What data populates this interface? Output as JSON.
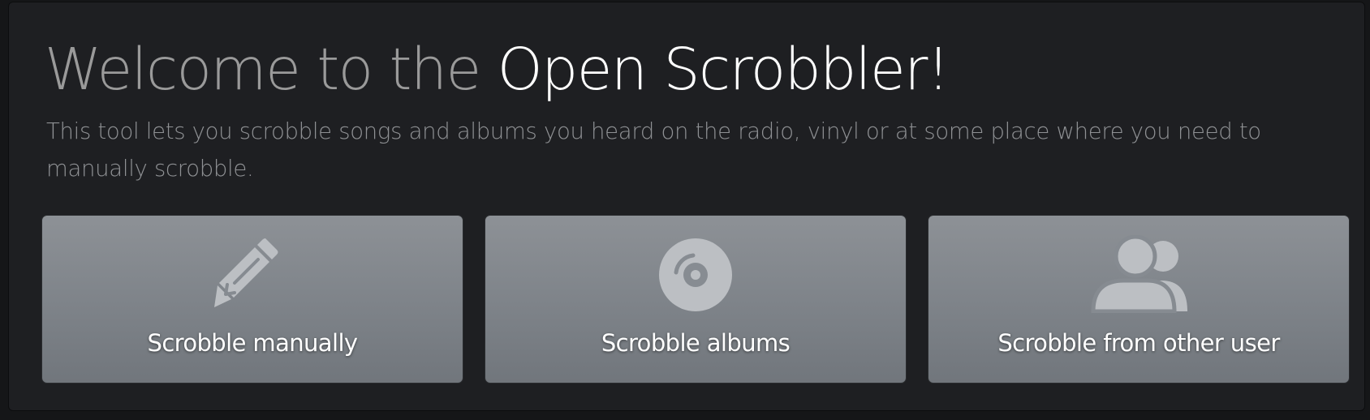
{
  "header": {
    "title_prefix": "Welcome to the ",
    "title_brand": "Open Scrobbler!",
    "subtitle": "This tool lets you scrobble songs and albums you heard on the radio, vinyl or at some place where you need to manually scrobble."
  },
  "cards": [
    {
      "label": "Scrobble manually",
      "icon": "pencil-icon"
    },
    {
      "label": "Scrobble albums",
      "icon": "record-disc-icon"
    },
    {
      "label": "Scrobble from other user",
      "icon": "users-icon"
    }
  ],
  "colors": {
    "page_background": "#151618",
    "panel_background": "#1e1f22",
    "card_gradient_top": "#8d9196",
    "card_gradient_bottom": "#71767c",
    "icon_fill": "#bcbfc3",
    "title_muted": "#9a9a9a",
    "title_brand": "#ffffff"
  }
}
